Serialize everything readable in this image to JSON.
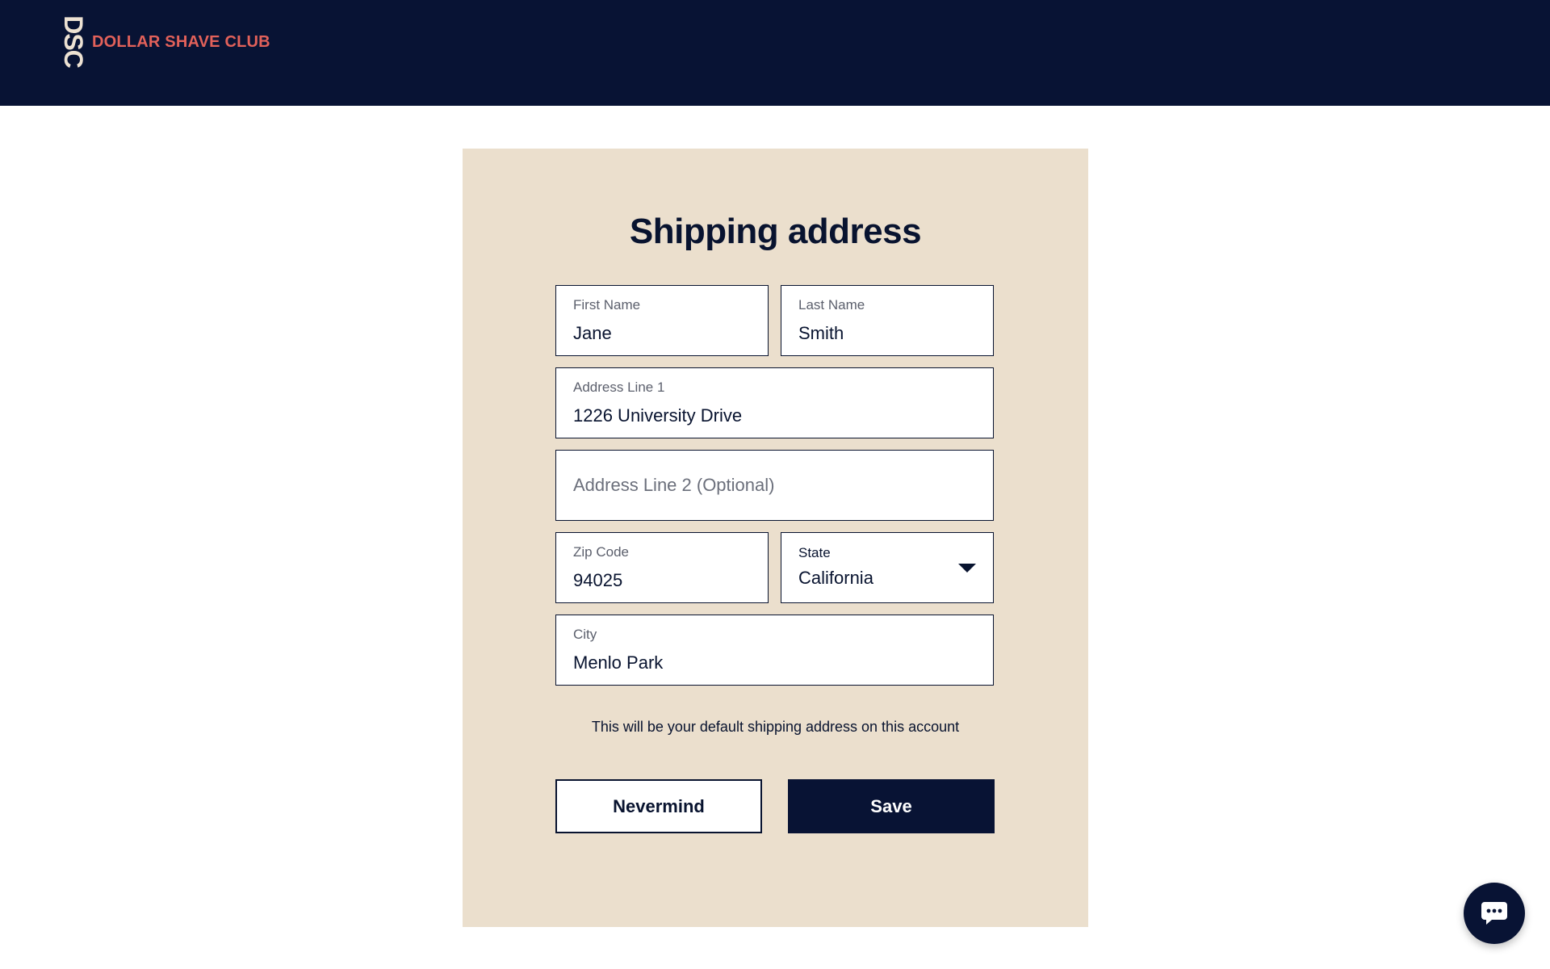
{
  "header": {
    "logo_mark": "DSC",
    "brand_name": "DOLLAR SHAVE CLUB"
  },
  "form": {
    "title": "Shipping address",
    "first_name": {
      "label": "First Name",
      "value": "Jane"
    },
    "last_name": {
      "label": "Last Name",
      "value": "Smith"
    },
    "address_line_1": {
      "label": "Address Line 1",
      "value": "1226 University Drive"
    },
    "address_line_2": {
      "placeholder": "Address Line 2 (Optional)"
    },
    "zip_code": {
      "label": "Zip Code",
      "value": "94025"
    },
    "state": {
      "label": "State",
      "value": "California"
    },
    "city": {
      "label": "City",
      "value": "Menlo Park"
    },
    "note": "This will be your default shipping address on this account",
    "nevermind_label": "Nevermind",
    "save_label": "Save"
  },
  "icons": {
    "state_dropdown": "caret-down-icon",
    "chat": "chat-bubble-icon"
  },
  "colors": {
    "header_bg": "#081334",
    "brand_text": "#e2615a",
    "card_bg": "#ebdfcd",
    "primary_button": "#081334"
  }
}
